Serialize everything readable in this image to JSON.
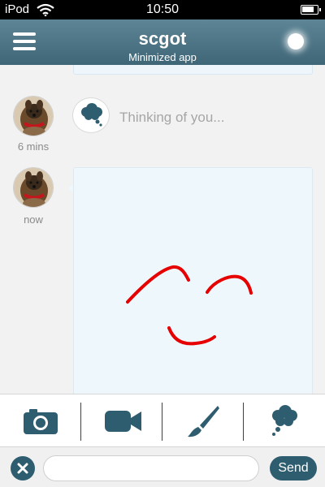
{
  "status_bar": {
    "carrier": "iPod",
    "time": "10:50",
    "battery_level": 0.85,
    "icons": [
      "wifi-icon",
      "battery-icon"
    ]
  },
  "header": {
    "title": "scgot",
    "subtitle": "Minimized app",
    "menu_icon": "hamburger-icon",
    "presence_icon": "online-indicator"
  },
  "messages": [
    {
      "type": "thought",
      "time": "6 mins",
      "text": "Thinking of you...",
      "icon": "thought-cloud-icon"
    },
    {
      "type": "drawing",
      "time": "now",
      "drawing_color": "#e60000",
      "drawing_content": "smiley-face"
    }
  ],
  "toolbar": {
    "items": [
      {
        "icon": "camera-icon"
      },
      {
        "icon": "video-camera-icon"
      },
      {
        "icon": "paintbrush-icon"
      },
      {
        "icon": "thought-cloud-icon"
      }
    ]
  },
  "input_bar": {
    "clear_icon": "close-icon",
    "value": "",
    "placeholder": "",
    "send_label": "Send"
  },
  "colors": {
    "header": "#4a7385",
    "accent": "#2f5d70",
    "drawing_bubble": "#eef7fc",
    "ink": "#e60000"
  }
}
